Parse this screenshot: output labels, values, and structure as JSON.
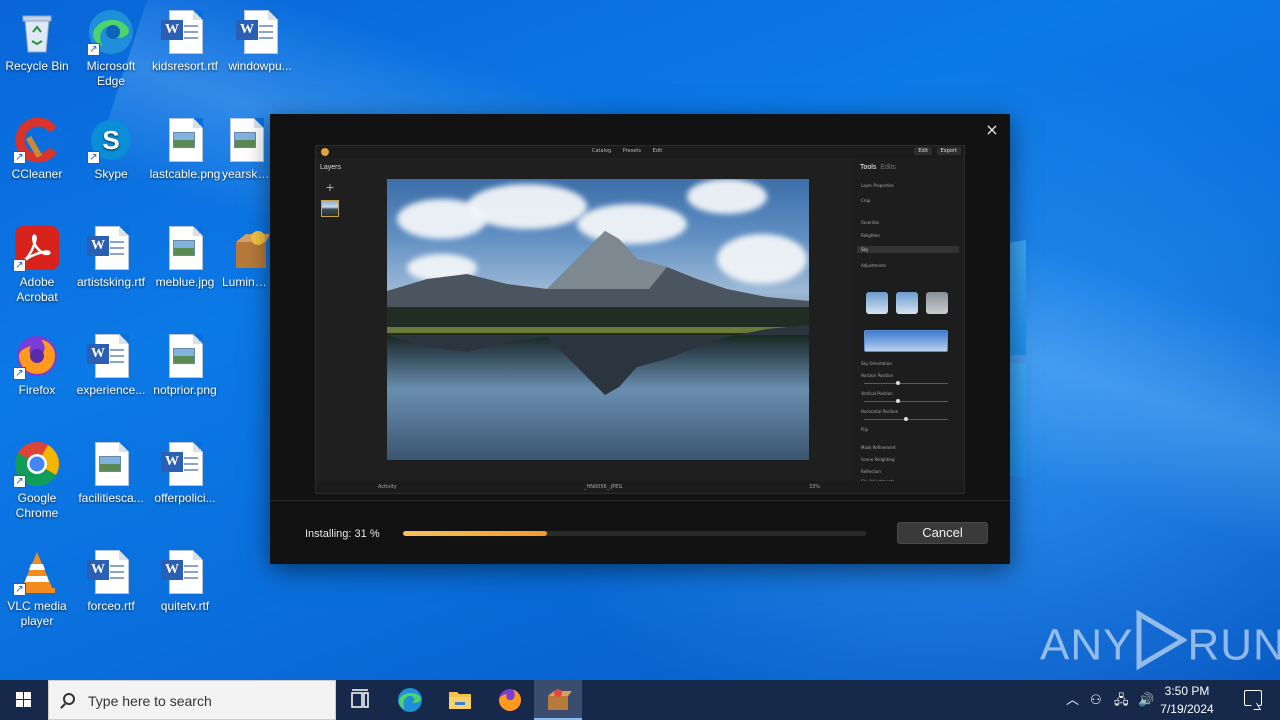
{
  "desktop": {
    "icons": [
      {
        "label": "Recycle Bin"
      },
      {
        "label": "Microsoft Edge"
      },
      {
        "label": "kidsresort.rtf"
      },
      {
        "label": "windowpu..."
      },
      {
        "label": "CCleaner"
      },
      {
        "label": "Skype"
      },
      {
        "label": "lastcable.png"
      },
      {
        "label": "yearskb..."
      },
      {
        "label": "Adobe Acrobat"
      },
      {
        "label": "artistsking.rtf"
      },
      {
        "label": "meblue.jpg"
      },
      {
        "label": "Lumina..."
      },
      {
        "label": "Firefox"
      },
      {
        "label": "experience..."
      },
      {
        "label": "notprior.png"
      },
      {
        "label": "Google Chrome"
      },
      {
        "label": "facilitiesca..."
      },
      {
        "label": "offerpolici..."
      },
      {
        "label": "VLC media player"
      },
      {
        "label": "forceo.rtf"
      },
      {
        "label": "quitetv.rtf"
      }
    ]
  },
  "installer": {
    "close_glyph": "×",
    "preview": {
      "nav": [
        "Catalog",
        "Presets",
        "Edit"
      ],
      "buttons": [
        "Edit",
        "Export"
      ],
      "layers_title": "Layers",
      "add_glyph": "+",
      "tools_tabs": {
        "active": "Tools",
        "inactive": "Edits"
      },
      "tool_rows": [
        "Layer Properties",
        "Crop",
        "Favorites",
        "Relighten",
        "Sky",
        "Adjustments",
        "Sky Orientation",
        "Horizon Position",
        "Vertical Position",
        "Horizontal Position",
        "Flip",
        "Mask Refinement",
        "Scene Relighting",
        "Reflection",
        "Sky Adjustments"
      ],
      "filename": "_HN0056_.JPEG",
      "zoom": "33%",
      "activity": "Activity"
    },
    "status_text": "Installing: 31 %",
    "progress_fraction": 0.31,
    "cancel_label": "Cancel"
  },
  "watermark": {
    "text_left": "ANY",
    "text_right": "RUN"
  },
  "taskbar": {
    "search_placeholder": "Type here to search",
    "time": "3:50 PM",
    "date": "7/19/2024"
  },
  "colors": {
    "progress_start": "#f7c25a",
    "progress_end": "#f29a2e",
    "taskbar": "#16294a",
    "dialog": "#121212"
  }
}
